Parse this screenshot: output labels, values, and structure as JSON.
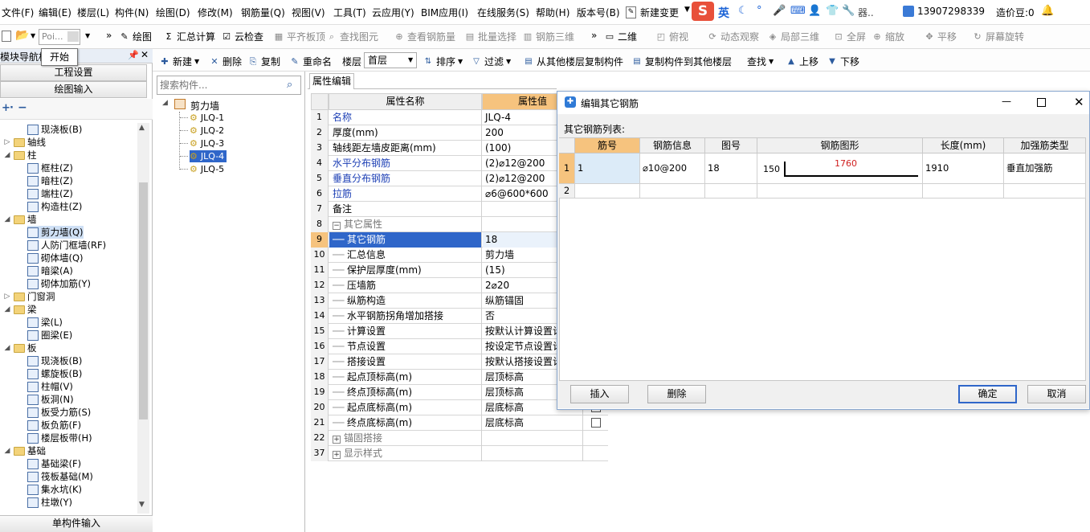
{
  "menu": [
    "文件(F)",
    "编辑(E)",
    "楼层(L)",
    "构件(N)",
    "绘图(D)",
    "修改(M)",
    "钢筋量(Q)",
    "视图(V)",
    "工具(T)",
    "云应用(Y)",
    "BIM应用(I)",
    "在线服务(S)",
    "帮助(H)",
    "版本号(B)",
    "新建变更"
  ],
  "ime": {
    "lang": "英",
    "tray": "器.."
  },
  "account": {
    "phone": "13907298339",
    "beans": "造价豆:0"
  },
  "toolbar1": {
    "poi": "Poi...",
    "items": [
      "绘图",
      "汇总计算",
      "云检查",
      "平齐板顶",
      "查找图元",
      "查看钢筋量",
      "批量选择",
      "钢筋三维",
      "二维",
      "俯视",
      "动态观察",
      "局部三维",
      "全屏",
      "缩放",
      "平移",
      "屏幕旋转"
    ]
  },
  "tooltip": "开始",
  "left": {
    "title": "模块导航栏",
    "btn_settings": "工程设置",
    "btn_draw": "绘图输入",
    "btn_single": "单构件输入",
    "tree": [
      {
        "label": "现浇板(B)",
        "level": 2,
        "icon": "slab-icon"
      },
      {
        "label": "轴线",
        "level": 1,
        "folder": true,
        "open": false
      },
      {
        "label": "柱",
        "level": 1,
        "folder": true,
        "open": true
      },
      {
        "label": "框柱(Z)",
        "level": 2,
        "icon": "column-icon"
      },
      {
        "label": "暗柱(Z)",
        "level": 2,
        "icon": "column-icon"
      },
      {
        "label": "端柱(Z)",
        "level": 2,
        "icon": "column-icon"
      },
      {
        "label": "构造柱(Z)",
        "level": 2,
        "icon": "column-icon"
      },
      {
        "label": "墙",
        "level": 1,
        "folder": true,
        "open": true
      },
      {
        "label": "剪力墙(Q)",
        "level": 2,
        "icon": "wall-icon",
        "selected": true
      },
      {
        "label": "人防门框墙(RF)",
        "level": 2,
        "icon": "wall-icon"
      },
      {
        "label": "砌体墙(Q)",
        "level": 2,
        "icon": "wall-icon"
      },
      {
        "label": "暗梁(A)",
        "level": 2,
        "icon": "beam-icon"
      },
      {
        "label": "砌体加筋(Y)",
        "level": 2,
        "icon": "wall-icon"
      },
      {
        "label": "门窗洞",
        "level": 1,
        "folder": true,
        "open": false
      },
      {
        "label": "梁",
        "level": 1,
        "folder": true,
        "open": true
      },
      {
        "label": "梁(L)",
        "level": 2,
        "icon": "beam-icon"
      },
      {
        "label": "圈梁(E)",
        "level": 2,
        "icon": "beam-icon"
      },
      {
        "label": "板",
        "level": 1,
        "folder": true,
        "open": true
      },
      {
        "label": "现浇板(B)",
        "level": 2,
        "icon": "slab-icon"
      },
      {
        "label": "螺旋板(B)",
        "level": 2,
        "icon": "slab-icon"
      },
      {
        "label": "柱帽(V)",
        "level": 2,
        "icon": "slab-icon"
      },
      {
        "label": "板洞(N)",
        "level": 2,
        "icon": "slab-icon"
      },
      {
        "label": "板受力筋(S)",
        "level": 2,
        "icon": "rebar-icon"
      },
      {
        "label": "板负筋(F)",
        "level": 2,
        "icon": "rebar-icon"
      },
      {
        "label": "楼层板带(H)",
        "level": 2,
        "icon": "rebar-icon"
      },
      {
        "label": "基础",
        "level": 1,
        "folder": true,
        "open": true
      },
      {
        "label": "基础梁(F)",
        "level": 2,
        "icon": "beam-icon"
      },
      {
        "label": "筏板基础(M)",
        "level": 2,
        "icon": "slab-icon"
      },
      {
        "label": "集水坑(K)",
        "level": 2,
        "icon": "pit-icon"
      },
      {
        "label": "柱墩(Y)",
        "level": 2,
        "icon": "column-icon"
      }
    ]
  },
  "toolbar2": {
    "new": "新建",
    "delete": "删除",
    "copy": "复制",
    "rename": "重命名",
    "floor_label": "楼层",
    "floor_value": "首层",
    "sort": "排序",
    "filter": "过滤",
    "copy_from": "从其他楼层复制构件",
    "copy_to": "复制构件到其他楼层",
    "find": "查找",
    "up": "上移",
    "down": "下移"
  },
  "components": {
    "search_placeholder": "搜索构件...",
    "root": "剪力墙",
    "items": [
      "JLQ-1",
      "JLQ-2",
      "JLQ-3",
      "JLQ-4",
      "JLQ-5"
    ],
    "selected": "JLQ-4"
  },
  "props": {
    "tab": "属性编辑",
    "col_name": "属性名称",
    "col_value": "属性值",
    "rows": [
      {
        "n": "1",
        "name": "名称",
        "value": "JLQ-4",
        "blue": true
      },
      {
        "n": "2",
        "name": "厚度(mm)",
        "value": "200"
      },
      {
        "n": "3",
        "name": "轴线距左墙皮距离(mm)",
        "value": "(100)"
      },
      {
        "n": "4",
        "name": "水平分布钢筋",
        "value": "(2)⌀12@200",
        "blue": true
      },
      {
        "n": "5",
        "name": "垂直分布钢筋",
        "value": "(2)⌀12@200",
        "blue": true
      },
      {
        "n": "6",
        "name": "拉筋",
        "value": "⌀6@600*600",
        "blue": true
      },
      {
        "n": "7",
        "name": "备注",
        "value": ""
      },
      {
        "n": "8",
        "name": "其它属性",
        "value": "",
        "group": true
      },
      {
        "n": "9",
        "name": "其它钢筋",
        "value": "18",
        "selected": true
      },
      {
        "n": "10",
        "name": "汇总信息",
        "value": "剪力墙"
      },
      {
        "n": "11",
        "name": "保护层厚度(mm)",
        "value": "(15)"
      },
      {
        "n": "12",
        "name": "压墙筋",
        "value": "2⌀20"
      },
      {
        "n": "13",
        "name": "纵筋构造",
        "value": "纵筋锚固"
      },
      {
        "n": "14",
        "name": "水平钢筋拐角增加搭接",
        "value": "否"
      },
      {
        "n": "15",
        "name": "计算设置",
        "value": "按默认计算设置计"
      },
      {
        "n": "16",
        "name": "节点设置",
        "value": "按设定节点设置计"
      },
      {
        "n": "17",
        "name": "搭接设置",
        "value": "按默认搭接设置计"
      },
      {
        "n": "18",
        "name": "起点顶标高(m)",
        "value": "层顶标高"
      },
      {
        "n": "19",
        "name": "终点顶标高(m)",
        "value": "层顶标高"
      },
      {
        "n": "20",
        "name": "起点底标高(m)",
        "value": "层底标高",
        "check": true
      },
      {
        "n": "21",
        "name": "终点底标高(m)",
        "value": "层底标高",
        "check": true
      },
      {
        "n": "22",
        "name": "锚固搭接",
        "value": "",
        "group": true,
        "collapsed": true
      },
      {
        "n": "37",
        "name": "显示样式",
        "value": "",
        "group": true,
        "collapsed": true
      }
    ]
  },
  "dialog": {
    "title": "编辑其它钢筋",
    "list_label": "其它钢筋列表:",
    "headers": [
      "筋号",
      "钢筋信息",
      "图号",
      "钢筋图形",
      "长度(mm)",
      "加强筋类型"
    ],
    "rows": [
      {
        "n": "1",
        "bar_no": "1",
        "info": "⌀10@200",
        "fig": "18",
        "shape_left": "150",
        "shape_len": "1760",
        "length": "1910",
        "type": "垂直加强筋"
      },
      {
        "n": "2",
        "bar_no": "",
        "info": "",
        "fig": "",
        "shape_left": "",
        "shape_len": "",
        "length": "",
        "type": ""
      }
    ],
    "btn_insert": "插入",
    "btn_delete": "删除",
    "btn_ok": "确定",
    "btn_cancel": "取消"
  }
}
